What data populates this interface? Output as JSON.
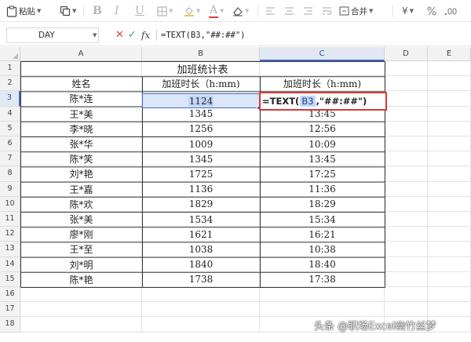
{
  "toolbar": {
    "paste_label": "粘贴",
    "format_painter_label": "",
    "bold": "B",
    "italic": "I",
    "underline": "U",
    "font_color": "A",
    "merge_label": "合并",
    "currency": "¥"
  },
  "formula_bar": {
    "name_box": "DAY",
    "cancel": "✕",
    "confirm": "✓",
    "fx": "fx",
    "formula": "=TEXT(B3,\"##:##\")"
  },
  "columns": [
    "A",
    "B",
    "C",
    "D",
    "E"
  ],
  "rows": [
    "1",
    "2",
    "3",
    "4",
    "5",
    "6",
    "7",
    "8",
    "9",
    "10",
    "11",
    "12",
    "13",
    "14",
    "15",
    "16",
    "17",
    "18"
  ],
  "sheet": {
    "title": "加班统计表",
    "headers": [
      "姓名",
      "加班时长（h:mm)",
      "加班时长（h:mm)"
    ],
    "active_cell_value": "1124",
    "edit": {
      "prefix": "=TEXT(",
      "ref": "B3",
      "suffix": ",\"##:##\")"
    },
    "data": [
      {
        "name": "王*美",
        "raw": "1345",
        "formatted": "13:45"
      },
      {
        "name": "李*晓",
        "raw": "1256",
        "formatted": "12:56"
      },
      {
        "name": "张*华",
        "raw": "1009",
        "formatted": "10:09"
      },
      {
        "name": "陈*笑",
        "raw": "1345",
        "formatted": "13:45"
      },
      {
        "name": "刘*艳",
        "raw": "1725",
        "formatted": "17:25"
      },
      {
        "name": "王*嘉",
        "raw": "1136",
        "formatted": "11:36"
      },
      {
        "name": "陈*欢",
        "raw": "1829",
        "formatted": "18:29"
      },
      {
        "name": "张*美",
        "raw": "1534",
        "formatted": "15:34"
      },
      {
        "name": "廖*刚",
        "raw": "1621",
        "formatted": "16:21"
      },
      {
        "name": "王*至",
        "raw": "1038",
        "formatted": "10:38"
      },
      {
        "name": "刘*明",
        "raw": "1840",
        "formatted": "18:40"
      },
      {
        "name": "陈*艳",
        "raw": "1738",
        "formatted": "17:38"
      }
    ],
    "first_name": "陈*连"
  },
  "watermark": "头条 @职场Excel幽竹丝梦",
  "colors": {
    "accent": "#3c6bc8",
    "edit_border": "#d83a35",
    "selection_fill": "#dbe6fb"
  }
}
